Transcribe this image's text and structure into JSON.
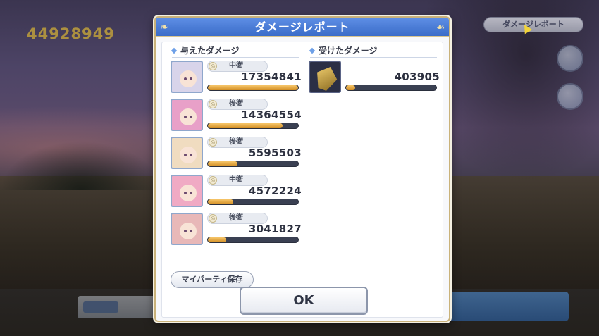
{
  "hud": {
    "score": "44928949",
    "top_button_label": "ダメージレポート"
  },
  "dialog": {
    "title": "ダメージレポート",
    "dealt_header": "与えたダメージ",
    "received_header": "受けたダメージ",
    "dealt": [
      {
        "role": "中衛",
        "damage": "17354841",
        "bar_fraction": 1.0,
        "avatar_color": "#d8d4ea"
      },
      {
        "role": "後衛",
        "damage": "14364554",
        "bar_fraction": 0.83,
        "avatar_color": "#e8a0c8"
      },
      {
        "role": "後衛",
        "damage": "5595503",
        "bar_fraction": 0.33,
        "avatar_color": "#f0dcc0"
      },
      {
        "role": "中衛",
        "damage": "4572224",
        "bar_fraction": 0.28,
        "avatar_color": "#f0aac4"
      },
      {
        "role": "後衛",
        "damage": "3041827",
        "bar_fraction": 0.2,
        "avatar_color": "#e8b8b8"
      }
    ],
    "received": [
      {
        "damage": "403905",
        "bar_fraction": 0.1,
        "avatar_color": "#2b2f45"
      }
    ],
    "save_party_label": "マイパーティ保存",
    "ok_label": "OK"
  },
  "colors": {
    "title_bar": "#3a6cc8",
    "bar_fill": "#d28e24",
    "bar_track": "#3a4052"
  }
}
